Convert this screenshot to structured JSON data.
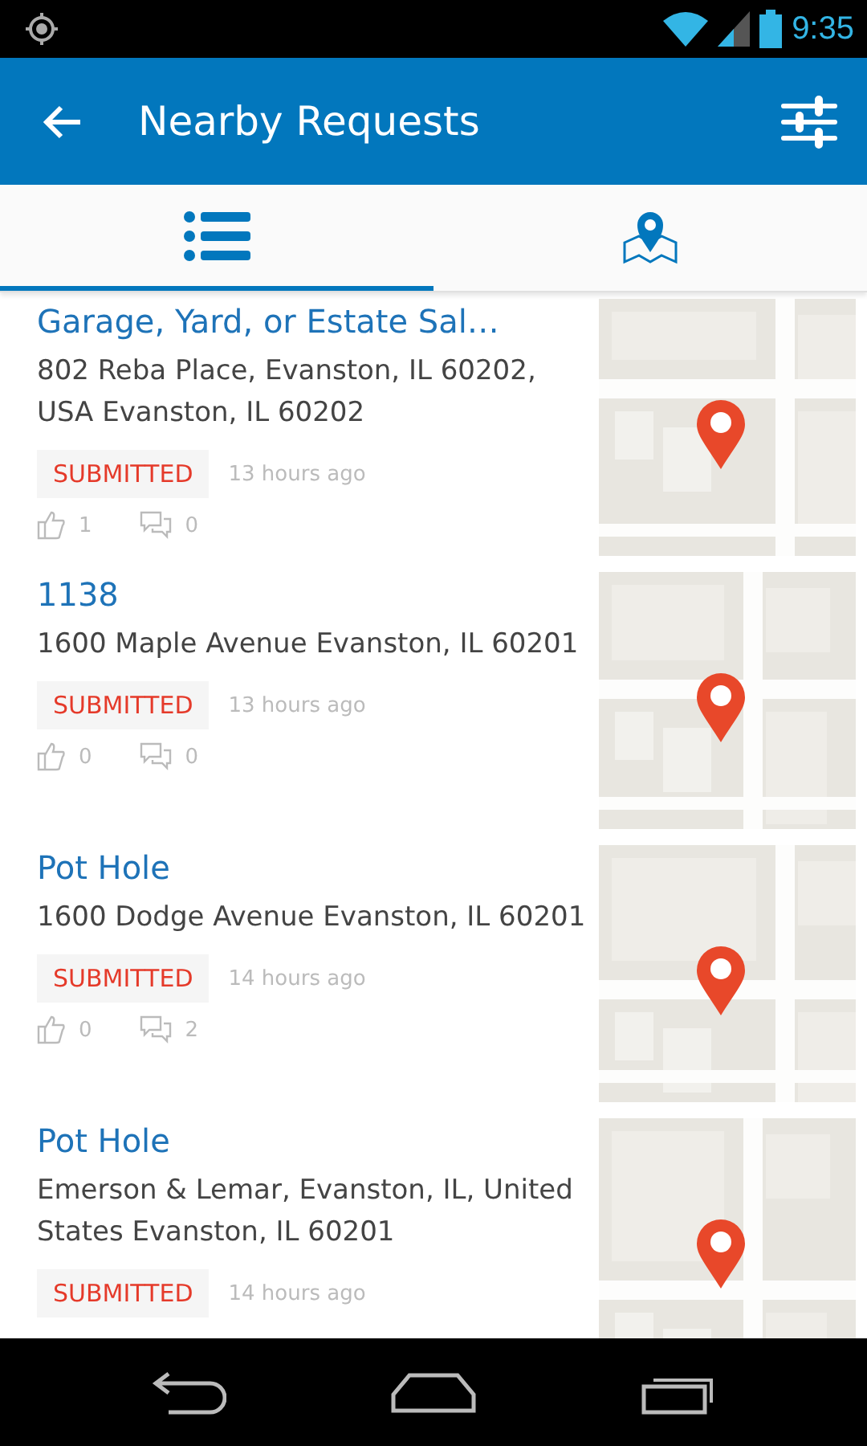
{
  "status_bar": {
    "time": "9:35"
  },
  "app_bar": {
    "title": "Nearby Requests"
  },
  "tabs": [
    {
      "kind": "list",
      "selected": true
    },
    {
      "kind": "map",
      "selected": false
    }
  ],
  "requests": [
    {
      "title": "Garage, Yard, or Estate Sal…",
      "address": "802 Reba Place, Evanston, IL 60202, USA Evanston, IL 60202",
      "status": "SUBMITTED",
      "time": "13 hours ago",
      "votes": "1",
      "comments": "0"
    },
    {
      "title": "1138",
      "address": "1600 Maple Avenue Evanston, IL 60201",
      "status": "SUBMITTED",
      "time": "13 hours ago",
      "votes": "0",
      "comments": "0"
    },
    {
      "title": "Pot Hole",
      "address": "1600 Dodge Avenue Evanston, IL 60201",
      "status": "SUBMITTED",
      "time": "14 hours ago",
      "votes": "0",
      "comments": "2"
    },
    {
      "title": "Pot Hole",
      "address": "Emerson & Lemar, Evanston, IL, United States Evanston, IL 60201",
      "status": "SUBMITTED",
      "time": "14 hours ago"
    }
  ]
}
